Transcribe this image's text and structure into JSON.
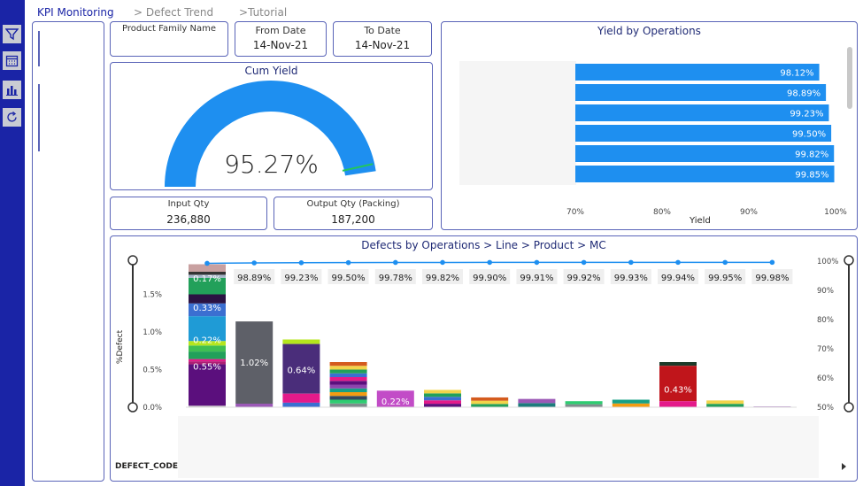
{
  "nav": {
    "tabs": [
      "KPI Monitoring",
      "> Defect Trend",
      ">Tutorial"
    ],
    "icons": [
      "filter-icon",
      "calendar-icon",
      "bar-chart-icon",
      "refresh-icon"
    ]
  },
  "filters": {
    "product_family_label": "Product Family Name",
    "from_label": "From Date",
    "from_value": "14-Nov-21",
    "to_label": "To Date",
    "to_value": "14-Nov-21"
  },
  "cum_yield": {
    "title": "Cum Yield",
    "value_text": "95.27%",
    "fraction": 0.9527,
    "color": "#1e8ff0"
  },
  "quantities": {
    "input_label": "Input Qty",
    "input_value": "236,880",
    "output_label": "Output Qty (Packing)",
    "output_value": "187,200"
  },
  "chart_data": [
    {
      "type": "bar",
      "title": "Yield by Operations",
      "orientation": "horizontal",
      "categories": [
        "",
        "",
        "",
        "",
        "",
        ""
      ],
      "values": [
        98.12,
        98.89,
        99.23,
        99.5,
        99.82,
        99.85
      ],
      "data_labels": [
        "98.12%",
        "98.89%",
        "99.23%",
        "99.50%",
        "99.82%",
        "99.85%"
      ],
      "xlabel": "Yield",
      "xlim": [
        70,
        100
      ],
      "xticks": [
        "70%",
        "80%",
        "90%",
        "100%"
      ],
      "bar_color": "#1e8ff0"
    },
    {
      "type": "bar",
      "title": "Defects by Operations > Line > Product > MC",
      "ylabel": "%Defect",
      "xlabel": "DEFECT_CODE",
      "ylim": [
        0,
        2.0
      ],
      "yticks": [
        "0.0%",
        "0.5%",
        "1.0%",
        "1.5%"
      ],
      "y2ticks": [
        "50%",
        "60%",
        "70%",
        "80%",
        "90%",
        "100%"
      ],
      "y2lim": [
        50,
        100
      ],
      "stack_totals": [
        1.9,
        1.14,
        0.9,
        0.6,
        0.22,
        0.23,
        0.13,
        0.11,
        0.08,
        0.1,
        0.6,
        0.09,
        0.01
      ],
      "bar_labels": [
        "0.22%",
        "1.02%",
        "0.64%",
        "",
        "0.22%",
        "",
        "",
        "",
        "",
        "",
        "0.43%",
        "",
        ""
      ],
      "cum_yield_line": [
        98.12,
        98.89,
        99.23,
        99.5,
        99.78,
        99.82,
        99.9,
        99.91,
        99.92,
        99.93,
        99.94,
        99.95,
        99.98
      ],
      "cum_labels": [
        "98.89%",
        "99.23%",
        "99.50%",
        "99.78%",
        "99.82%",
        "99.90%",
        "99.91%",
        "99.92%",
        "99.93%",
        "99.94%",
        "99.95%",
        "99.98%"
      ],
      "stacked_labels": [
        "0.17%",
        "0.33%",
        "0.55%"
      ],
      "line_color": "#1e8ff0"
    }
  ]
}
